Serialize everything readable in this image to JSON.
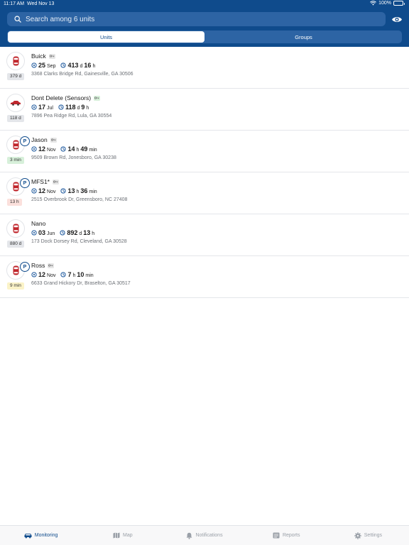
{
  "status_bar": {
    "time": "11:17 AM",
    "date": "Wed Nov 13",
    "battery": "100%"
  },
  "search": {
    "placeholder": "Search among 6 units"
  },
  "segments": [
    {
      "label": "Units",
      "active": true
    },
    {
      "label": "Groups",
      "active": false
    }
  ],
  "units": [
    {
      "name": "Buick",
      "name_key": "gray",
      "parked": false,
      "age": "379 d",
      "age_color": "gray",
      "date_day": "25",
      "date_month": "Sep",
      "duration": [
        {
          "v": "413",
          "u": "d"
        },
        {
          "v": "16",
          "u": "h"
        }
      ],
      "address": "3368 Clarks Bridge Rd, Gainesville, GA 30506"
    },
    {
      "name": "Dont Delete (Sensors)",
      "name_key": "green",
      "parked": false,
      "age": "118 d",
      "age_color": "gray",
      "date_day": "17",
      "date_month": "Jul",
      "duration": [
        {
          "v": "118",
          "u": "d"
        },
        {
          "v": "9",
          "u": "h"
        }
      ],
      "address": "7896 Pea Ridge Rd, Lula, GA 30554"
    },
    {
      "name": "Jason",
      "name_key": "gray",
      "parked": true,
      "age": "3 min",
      "age_color": "green",
      "date_day": "12",
      "date_month": "Nov",
      "duration": [
        {
          "v": "14",
          "u": "h"
        },
        {
          "v": "49",
          "u": "min"
        }
      ],
      "address": "9509 Brown Rd, Jonesboro, GA 30238"
    },
    {
      "name": "MFS1*",
      "name_key": "gray",
      "parked": true,
      "age": "13 h",
      "age_color": "red",
      "date_day": "12",
      "date_month": "Nov",
      "duration": [
        {
          "v": "13",
          "u": "h"
        },
        {
          "v": "36",
          "u": "min"
        }
      ],
      "address": "2515 Overbrook Dr, Greensboro, NC 27408"
    },
    {
      "name": "Nano",
      "name_key": "none",
      "parked": false,
      "age": "880 d",
      "age_color": "gray",
      "date_day": "03",
      "date_month": "Jun",
      "duration": [
        {
          "v": "892",
          "u": "d"
        },
        {
          "v": "13",
          "u": "h"
        }
      ],
      "address": "173 Dock Dorsey Rd, Cleveland, GA 30528"
    },
    {
      "name": "Ross",
      "name_key": "gray",
      "parked": true,
      "age": "9 min",
      "age_color": "yellow",
      "date_day": "12",
      "date_month": "Nov",
      "duration": [
        {
          "v": "7",
          "u": "h"
        },
        {
          "v": "10",
          "u": "min"
        }
      ],
      "address": "6633 Grand Hickory Dr, Braselton, GA 30517"
    }
  ],
  "tabs": [
    {
      "label": "Monitoring",
      "icon": "car-icon",
      "active": true
    },
    {
      "label": "Map",
      "icon": "map-icon",
      "active": false
    },
    {
      "label": "Notifications",
      "icon": "bell-icon",
      "active": false
    },
    {
      "label": "Reports",
      "icon": "reports-icon",
      "active": false
    },
    {
      "label": "Settings",
      "icon": "gear-icon",
      "active": false
    }
  ],
  "colors": {
    "brand": "#0f4b8c",
    "search_bg": "#2d64a4",
    "car_red": "#c0272d"
  }
}
